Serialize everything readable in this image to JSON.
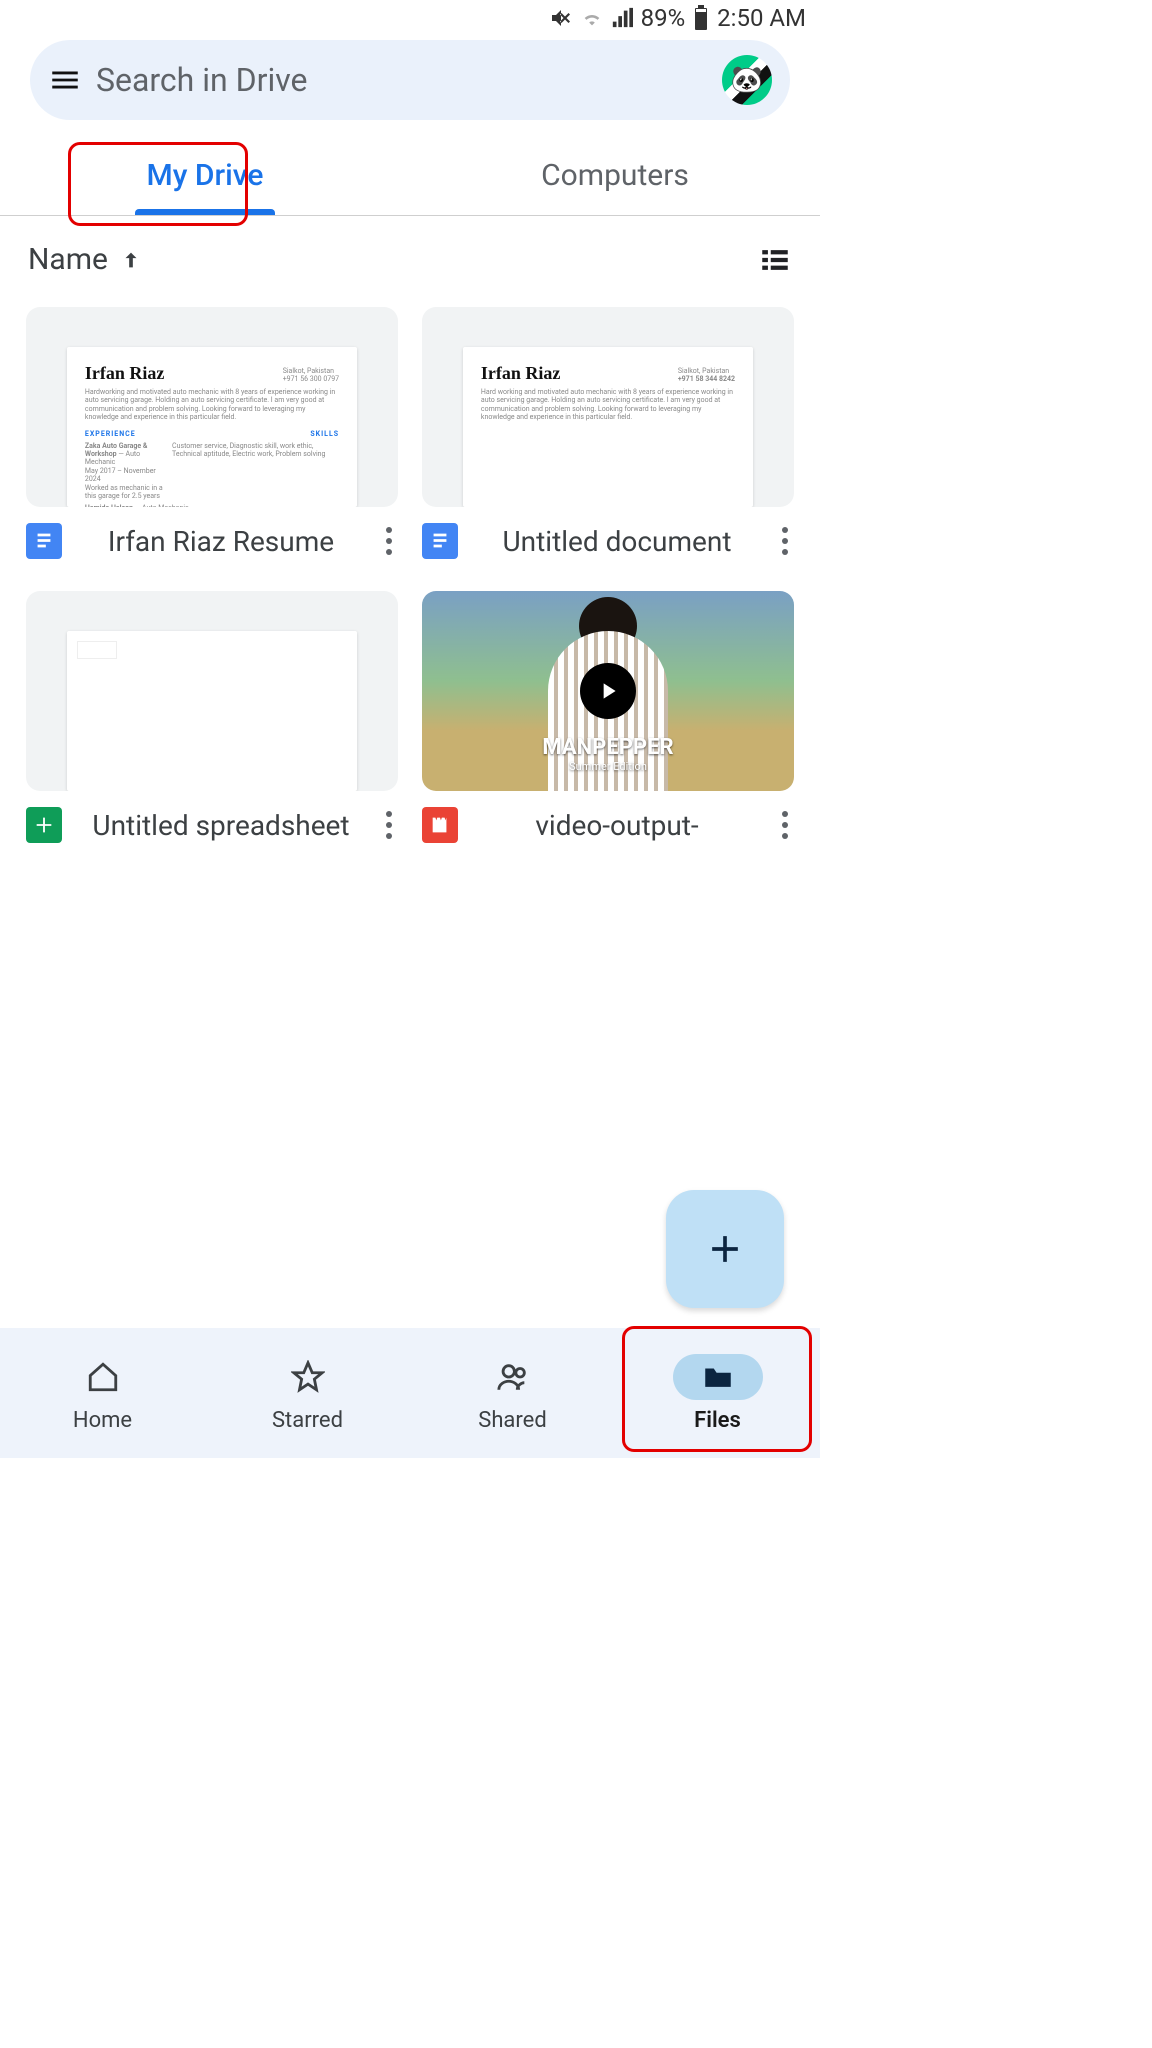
{
  "status_bar": {
    "battery": "89%",
    "time": "2:50 AM"
  },
  "search": {
    "placeholder": "Search in Drive"
  },
  "tabs": {
    "my_drive": "My Drive",
    "computers": "Computers"
  },
  "sort": {
    "label": "Name"
  },
  "files": [
    {
      "name": "Irfan Riaz Resume",
      "preview_title": "Irfan Riaz",
      "type": "doc"
    },
    {
      "name": "Untitled document",
      "preview_title": "Irfan Riaz",
      "type": "doc"
    },
    {
      "name": "Untitled spreadsheet",
      "type": "sheet"
    },
    {
      "name": "video-output-",
      "overlay_title": "MANPEPPER",
      "overlay_sub": "Summer Edition",
      "type": "video"
    }
  ],
  "bottom_nav": {
    "home": "Home",
    "starred": "Starred",
    "shared": "Shared",
    "files": "Files"
  }
}
